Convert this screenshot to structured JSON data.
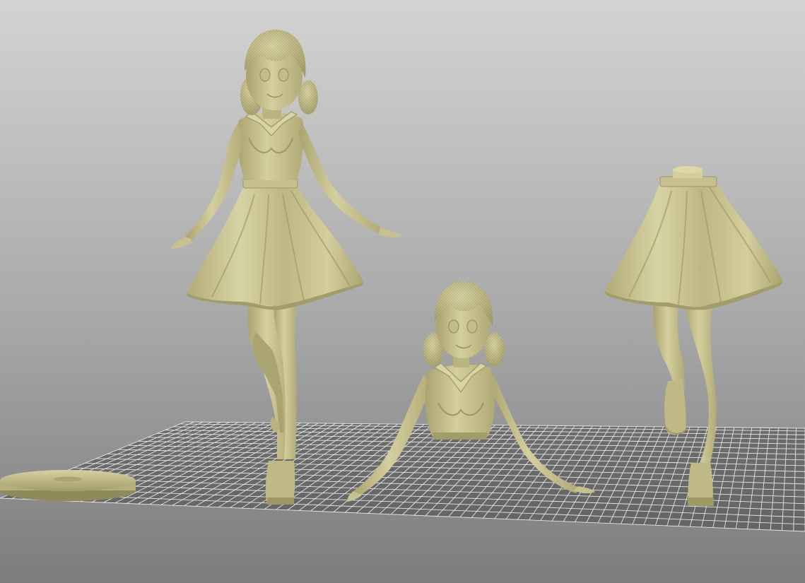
{
  "scene": {
    "background_top": "#d2d2d2",
    "background_bottom": "#7e7e7e",
    "grid_color": "#e6e6e6",
    "grid_shadow": "#3a3a3a",
    "model_color": "#c9c392",
    "model_shadow": "#8f8a5c",
    "model_highlight": "#e4dfb4",
    "objects": [
      "base-disc",
      "full-figure",
      "bust-with-arms",
      "skirt-and-legs"
    ]
  }
}
